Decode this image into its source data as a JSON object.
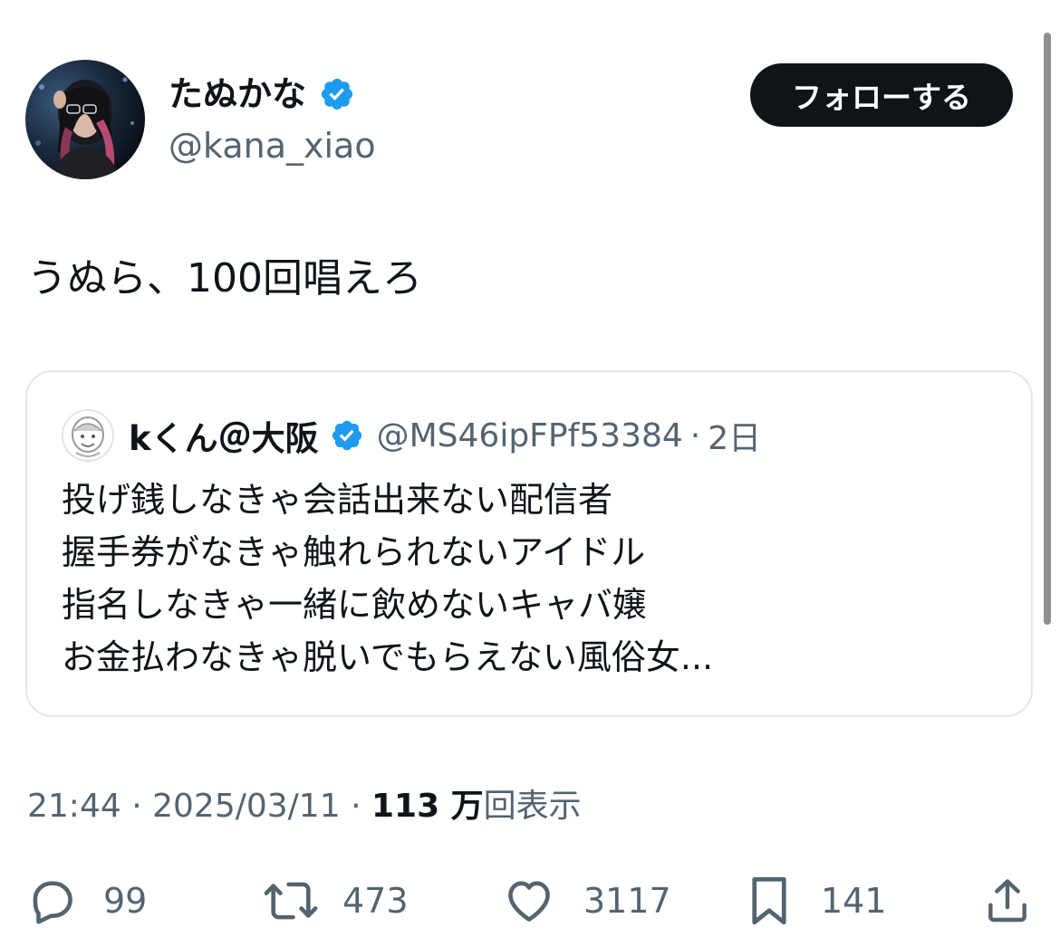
{
  "author": {
    "display_name": "たぬかな",
    "handle": "@kana_xiao",
    "avatar_icon": "profile-photo",
    "verified_icon": "verified-badge-icon"
  },
  "follow_button": {
    "label": "フォローする"
  },
  "tweet": {
    "text": "うぬら、100回唱えろ"
  },
  "quoted_tweet": {
    "display_name": "kくん＠大阪",
    "handle": "@MS46ipFPf53384",
    "separator": "·",
    "time": "2日",
    "lines": [
      "投げ銭しなきゃ会話出来ない配信者",
      "握手券がなきゃ触れられないアイドル",
      "指名しなきゃ一緒に飲めないキャバ嬢",
      "お金払わなきゃ脱いでもらえない風俗女..."
    ]
  },
  "meta": {
    "time": "21:44",
    "separator": "·",
    "date": "2025/03/11",
    "views_count": "113 万",
    "views_label": "回表示"
  },
  "actions": {
    "reply": {
      "icon": "reply-icon",
      "count": "99"
    },
    "retweet": {
      "icon": "retweet-icon",
      "count": "473"
    },
    "like": {
      "icon": "heart-icon",
      "count": "3117"
    },
    "bookmark": {
      "icon": "bookmark-icon",
      "count": "141"
    },
    "share": {
      "icon": "share-icon"
    }
  },
  "colors": {
    "text_primary": "#0f1419",
    "text_secondary": "#536471",
    "verified_blue": "#1d9bf0",
    "button_bg": "#0f1419",
    "border": "#e4e7ea"
  }
}
